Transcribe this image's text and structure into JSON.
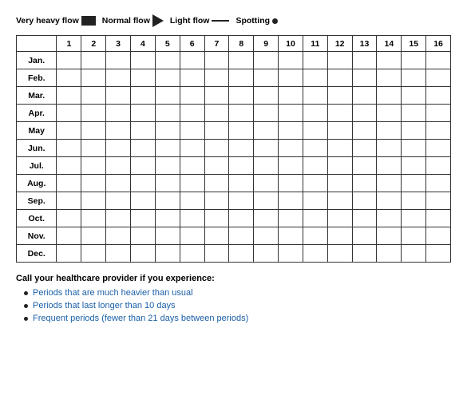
{
  "legend": {
    "items": [
      {
        "label": "Very heavy flow",
        "type": "box"
      },
      {
        "label": "Normal flow",
        "type": "arrow"
      },
      {
        "label": "Light flow",
        "type": "line"
      },
      {
        "label": "Spotting",
        "type": "dot"
      }
    ]
  },
  "table": {
    "columns": [
      "",
      "1",
      "2",
      "3",
      "4",
      "5",
      "6",
      "7",
      "8",
      "9",
      "10",
      "11",
      "12",
      "13",
      "14",
      "15",
      "16"
    ],
    "rows": [
      "Jan.",
      "Feb.",
      "Mar.",
      "Apr.",
      "May",
      "Jun.",
      "Jul.",
      "Aug.",
      "Sep.",
      "Oct.",
      "Nov.",
      "Dec."
    ]
  },
  "bottom": {
    "title": "Call your healthcare provider if you experience:",
    "bullets": [
      "Periods that are much heavier than usual",
      "Periods that last longer than 10 days",
      "Frequent periods (fewer than 21 days between periods)"
    ]
  }
}
